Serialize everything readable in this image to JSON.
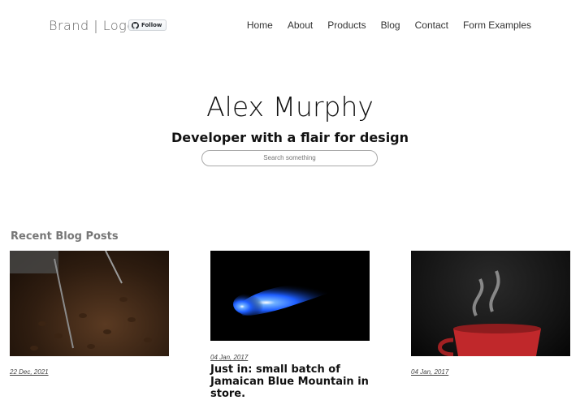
{
  "header": {
    "brand": "Brand | Logo",
    "follow_label": "Follow",
    "nav": [
      "Home",
      "About",
      "Products",
      "Blog",
      "Contact",
      "Form Examples"
    ]
  },
  "hero": {
    "name": "Alex Murphy",
    "tagline": "Developer with a flair for design",
    "search_placeholder": "Search something"
  },
  "recent": {
    "heading": "Recent Blog Posts",
    "posts": [
      {
        "date": "22 Dec, 2021",
        "title": "",
        "image": "coffee-beans"
      },
      {
        "date": "04 Jan, 2017",
        "title": "Just in: small batch of Jamaican Blue Mountain in store.",
        "image": "blue-light"
      },
      {
        "date": "04 Jan, 2017",
        "title": "",
        "image": "red-coffee-cup"
      }
    ]
  },
  "colors": {
    "accent_blue": "#2a7bff",
    "cup_red": "#c0282b"
  }
}
